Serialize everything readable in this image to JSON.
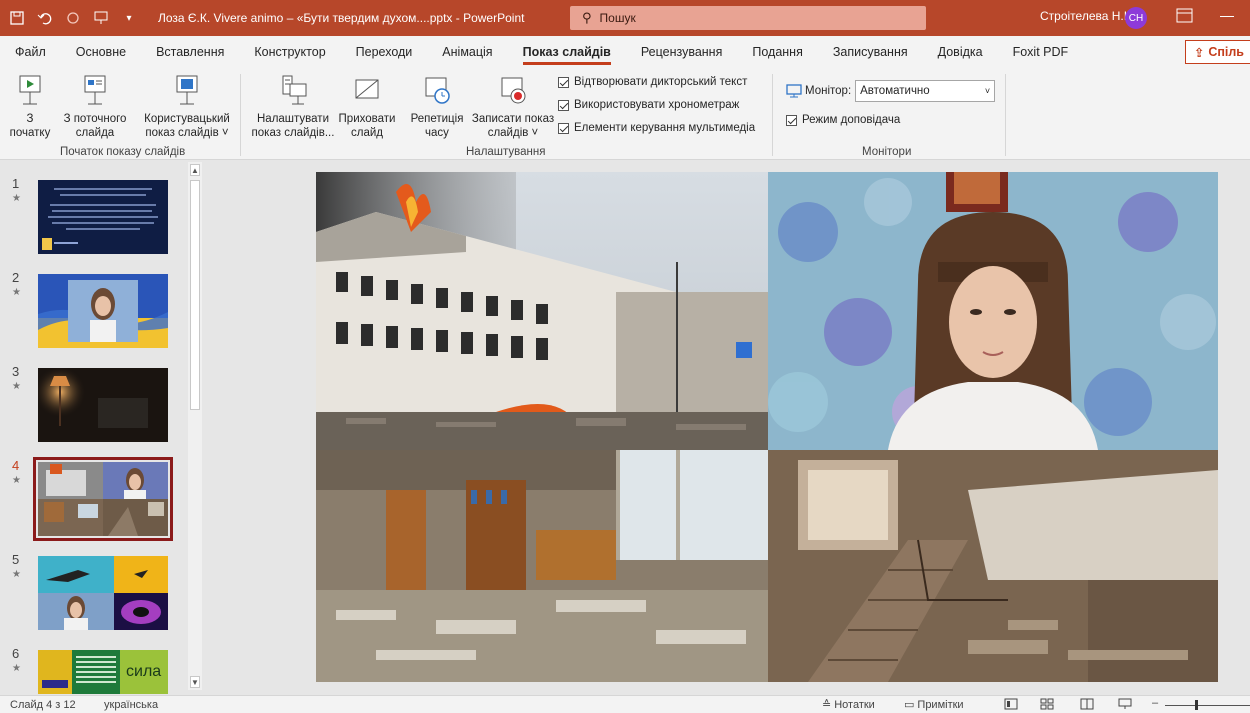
{
  "titlebar": {
    "title": "Лоза Є.К. Vivere animo – «Бути твердим духом....pptx  -  PowerPoint",
    "search_placeholder": "Пошук",
    "user_name": "Строітелева Н.І.",
    "user_initials": "СН"
  },
  "tabs": [
    "Файл",
    "Основне",
    "Вставлення",
    "Конструктор",
    "Переходи",
    "Анімація",
    "Показ слайдів",
    "Рецензування",
    "Подання",
    "Записування",
    "Довідка",
    "Foxit PDF"
  ],
  "active_tab": "Показ слайдів",
  "share_label": "Спіль",
  "ribbon": {
    "start_group": {
      "label": "Початок показу слайдів",
      "from_beginning": [
        "З",
        "початку"
      ],
      "from_current": [
        "З поточного",
        "слайда"
      ],
      "custom": [
        "Користувацький",
        "показ слайдів ˅"
      ]
    },
    "setup_group": {
      "label": "Налаштування",
      "setup_show": [
        "Налаштувати",
        "показ слайдів..."
      ],
      "hide_slide": [
        "Приховати",
        "слайд"
      ],
      "rehearse": [
        "Репетиція",
        "часу"
      ],
      "record": [
        "Записати показ",
        "слайдів ˅"
      ],
      "checks": [
        "Відтворювати дикторський текст",
        "Використовувати хронометраж",
        "Елементи керування мультимедіа"
      ]
    },
    "monitors_group": {
      "label": "Монітори",
      "monitor_label": "Монітор:",
      "monitor_value": "Автоматично",
      "presenter_view": "Режим доповідача"
    }
  },
  "thumbnails": [
    {
      "num": "1",
      "star": "★"
    },
    {
      "num": "2",
      "star": "★"
    },
    {
      "num": "3",
      "star": "★"
    },
    {
      "num": "4",
      "star": "★"
    },
    {
      "num": "5",
      "star": "★"
    },
    {
      "num": "6",
      "star": "★",
      "thumb_text": "сила волі"
    }
  ],
  "status": {
    "slide_info": "Слайд 4 з 12",
    "language": "українська",
    "notes": "Нотатки",
    "comments": "Примітки"
  },
  "colors": {
    "accent": "#b7472a",
    "active_underline": "#c43e1c",
    "avatar": "#8d3ad9"
  }
}
